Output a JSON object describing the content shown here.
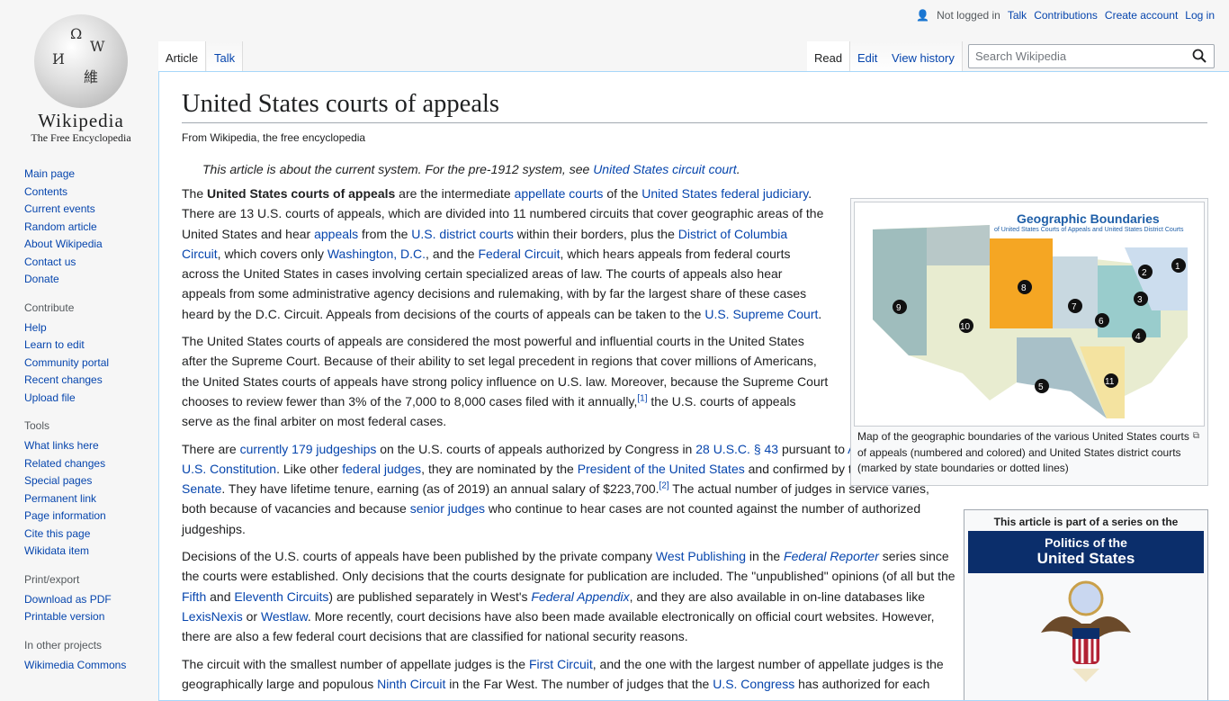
{
  "logo": {
    "wordmark": "Wikipedia",
    "tagline": "The Free Encyclopedia"
  },
  "personal": {
    "not_logged": "Not logged in",
    "links": [
      "Talk",
      "Contributions",
      "Create account",
      "Log in"
    ]
  },
  "tabs": {
    "article": "Article",
    "talk": "Talk",
    "read": "Read",
    "edit": "Edit",
    "history": "View history"
  },
  "search": {
    "placeholder": "Search Wikipedia"
  },
  "sidebar": {
    "nav": [
      "Main page",
      "Contents",
      "Current events",
      "Random article",
      "About Wikipedia",
      "Contact us",
      "Donate"
    ],
    "contribute": {
      "heading": "Contribute",
      "items": [
        "Help",
        "Learn to edit",
        "Community portal",
        "Recent changes",
        "Upload file"
      ]
    },
    "tools": {
      "heading": "Tools",
      "items": [
        "What links here",
        "Related changes",
        "Special pages",
        "Permanent link",
        "Page information",
        "Cite this page",
        "Wikidata item"
      ]
    },
    "print": {
      "heading": "Print/export",
      "items": [
        "Download as PDF",
        "Printable version"
      ]
    },
    "projects": {
      "heading": "In other projects",
      "items": [
        "Wikimedia Commons"
      ]
    }
  },
  "article": {
    "title": "United States courts of appeals",
    "tagline": "From Wikipedia, the free encyclopedia",
    "hatnote_text": "This article is about the current system. For the pre-1912 system, see ",
    "hatnote_link": "United States circuit court",
    "figure_title": "Geographic Boundaries",
    "figure_subtitle": "of United States Courts of Appeals and United States District Courts",
    "figure_caption": "Map of the geographic boundaries of the various United States courts of appeals (numbered and colored) and United States district courts (marked by state boundaries or dotted lines)",
    "infobox_top": "This article is part of a series on the",
    "infobox_l1": "Politics of the",
    "infobox_l2": "United States"
  },
  "colors": {
    "link": "#0645ad",
    "border": "#a7d7f9",
    "infobox_blue": "#0b2e6b"
  }
}
